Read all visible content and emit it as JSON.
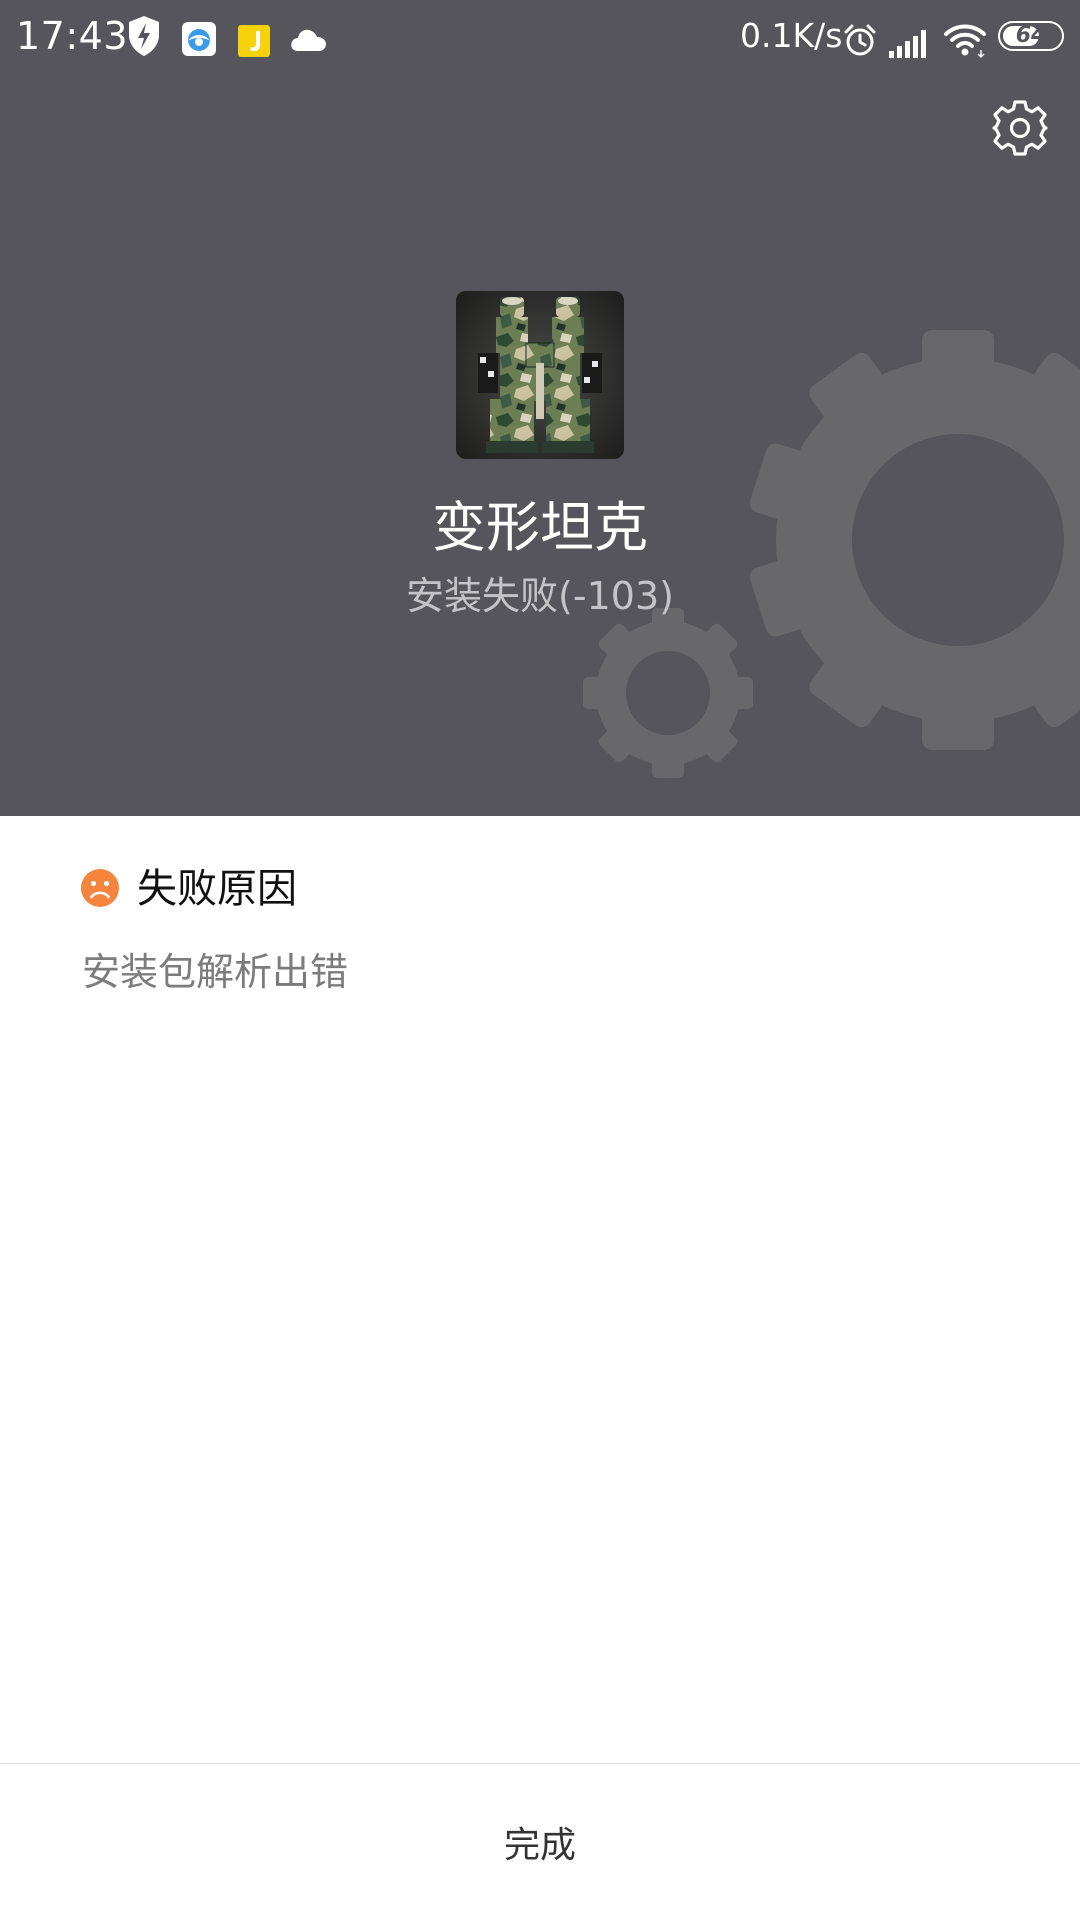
{
  "status_bar": {
    "time": "17:43",
    "network_speed": "0.1K/s",
    "battery_level": "64",
    "battery_fraction": 0.64,
    "icons": [
      "shield-icon",
      "browser-icon",
      "j-app-icon",
      "cloud-icon",
      "alarm-icon",
      "signal-icon",
      "wifi-icon",
      "battery-icon"
    ]
  },
  "header": {
    "settings_icon": "gear-icon",
    "background_color": "#55555b"
  },
  "app": {
    "name": "变形坦克",
    "status": "安装失败(-103)"
  },
  "failure": {
    "title": "失败原因",
    "icon": "sad-face-icon",
    "icon_color": "#f5843d",
    "reason": "安装包解析出错"
  },
  "footer": {
    "done_label": "完成"
  }
}
